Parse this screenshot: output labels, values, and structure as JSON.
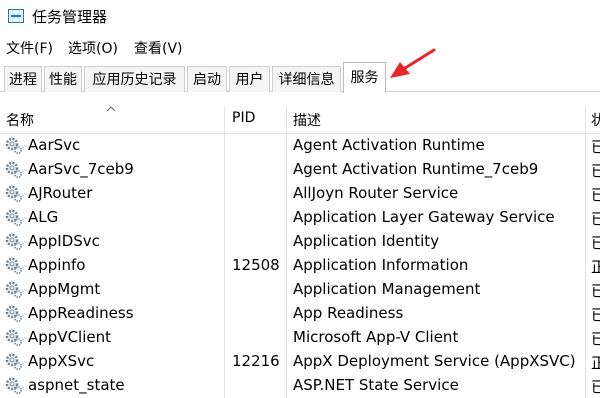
{
  "window": {
    "title": "任务管理器"
  },
  "menu": [
    "文件(F)",
    "选项(O)",
    "查看(V)"
  ],
  "tabs": [
    "进程",
    "性能",
    "应用历史记录",
    "启动",
    "用户",
    "详细信息",
    "服务"
  ],
  "active_tab": "服务",
  "columns": {
    "name": "名称",
    "pid": "PID",
    "description": "描述",
    "status": "状"
  },
  "services": [
    {
      "name": "AarSvc",
      "pid": "",
      "description": "Agent Activation Runtime",
      "status": "已"
    },
    {
      "name": "AarSvc_7ceb9",
      "pid": "",
      "description": "Agent Activation Runtime_7ceb9",
      "status": "已"
    },
    {
      "name": "AJRouter",
      "pid": "",
      "description": "AllJoyn Router Service",
      "status": "已"
    },
    {
      "name": "ALG",
      "pid": "",
      "description": "Application Layer Gateway Service",
      "status": "已"
    },
    {
      "name": "AppIDSvc",
      "pid": "",
      "description": "Application Identity",
      "status": "已"
    },
    {
      "name": "Appinfo",
      "pid": "12508",
      "description": "Application Information",
      "status": "正"
    },
    {
      "name": "AppMgmt",
      "pid": "",
      "description": "Application Management",
      "status": "已"
    },
    {
      "name": "AppReadiness",
      "pid": "",
      "description": "App Readiness",
      "status": "已"
    },
    {
      "name": "AppVClient",
      "pid": "",
      "description": "Microsoft App-V Client",
      "status": "已"
    },
    {
      "name": "AppXSvc",
      "pid": "12216",
      "description": "AppX Deployment Service (AppXSVC)",
      "status": "正"
    },
    {
      "name": "aspnet_state",
      "pid": "",
      "description": "ASP.NET State Service",
      "status": "已"
    }
  ],
  "colors": {
    "annotation_arrow": "#e8262a",
    "tab_border": "#cfcfcf",
    "gear_icon": "#6a7f95"
  },
  "icons": {
    "app": "task-manager-icon",
    "service": "gear-icon",
    "sort": "chevron-up-icon",
    "annotation": "red-arrow-icon"
  }
}
